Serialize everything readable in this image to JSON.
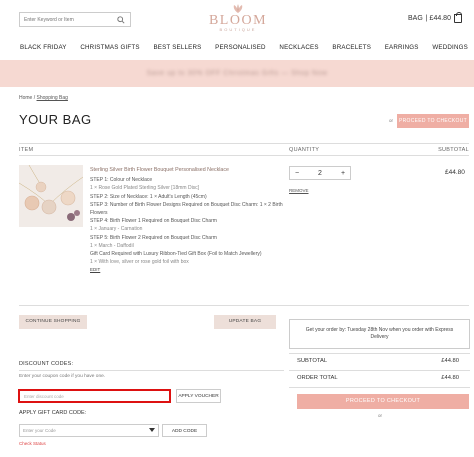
{
  "header": {
    "search_placeholder": "Enter Keyword or Item",
    "brand": "BLOOM",
    "brand_sub": "BOUTIQUE",
    "bag_label": "BAG",
    "bag_total": "| £44.80",
    "brand_color": "#d4a79a"
  },
  "nav": {
    "items": [
      "BLACK FRIDAY",
      "CHRISTMAS GIFTS",
      "BEST SELLERS",
      "PERSONALISED",
      "NECKLACES",
      "BRACELETS",
      "EARRINGS",
      "WEDDINGS"
    ]
  },
  "promo": {
    "text": "Save up to 30% OFF Christmas Gifts — Shop Now",
    "color": "#f6d9d2"
  },
  "breadcrumb": {
    "home": "Home",
    "sep": "/",
    "current": "Shopping Bag"
  },
  "page": {
    "title": "YOUR BAG",
    "or": "or",
    "checkout_label": "PROCEED TO CHECKOUT",
    "accent_color": "#efaea4"
  },
  "table": {
    "col_item": "ITEM",
    "col_qty": "QUANTITY",
    "col_subtotal": "SUBTOTAL"
  },
  "product": {
    "name": "Sterling Silver Birth Flower Bouquet Personalised Necklace",
    "lines": [
      {
        "text": "STEP 1: Colour of Necklace",
        "mute": false
      },
      {
        "text": "1 × Rose Gold Plated Sterling Silver [18mm Disc]",
        "mute": true
      },
      {
        "text": "STEP 2: Size of Necklace:  1 × Adult's Length (45cm)",
        "mute": false
      },
      {
        "text": "STEP 3: Number of Birth Flower Designs Required on Bouquet Disc Charm:  1 × 2 Birth Flowers",
        "mute": false
      },
      {
        "text": "STEP 4: Birth Flower 1 Required on Bouquet Disc Charm",
        "mute": false
      },
      {
        "text": "1 × January - Carnation",
        "mute": true
      },
      {
        "text": "STEP 5: Birth Flower 2 Required on Bouquet Disc Charm",
        "mute": false
      },
      {
        "text": "1 × March - Daffodil",
        "mute": true
      },
      {
        "text": "Gift Card Required with Luxury Ribbon-Tied Gift Box (Foil to Match Jewellery)",
        "mute": false
      },
      {
        "text": "1 × With love, silver or rose gold foil with box",
        "mute": true
      }
    ],
    "edit": "EDIT",
    "qty_minus": "−",
    "qty_value": "2",
    "qty_plus": "+",
    "remove": "REMOVE",
    "price": "£44.80"
  },
  "actions": {
    "continue": "CONTINUE SHOPPING",
    "update": "UPDATE BAG"
  },
  "discount": {
    "title": "DISCOUNT CODES:",
    "help": "Enter your coupon code if you have one.",
    "placeholder": "Enter discount code",
    "apply": "APPLY VOUCHER",
    "gift_title": "APPLY GIFT CARD CODE:",
    "gift_placeholder": "Enter your Code",
    "add_code": "ADD CODE",
    "check_status": "Check Status"
  },
  "summary": {
    "delivery_text": "Get your order by: Tuesday 28th Nov when you order with Express Delivery",
    "subtotal_label": "SUBTOTAL",
    "subtotal_value": "£44.80",
    "total_label": "ORDER TOTAL",
    "total_value": "£44.80",
    "checkout_label": "PROCEED TO CHECKOUT",
    "or": "or"
  }
}
